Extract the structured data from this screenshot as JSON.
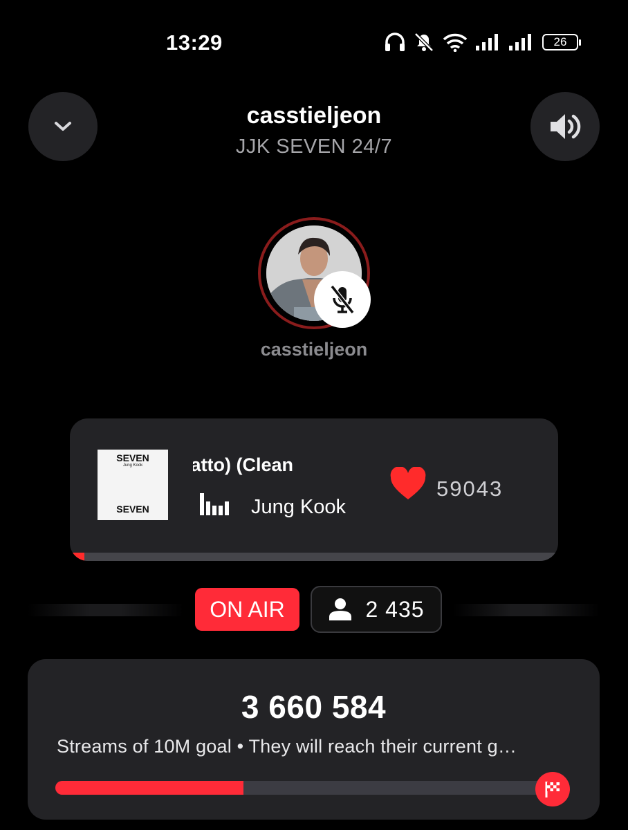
{
  "status_bar": {
    "time": "13:29",
    "battery": "26",
    "icons": [
      "headphones-icon",
      "bell-muted-icon",
      "wifi-icon",
      "signal-icon",
      "signal-icon",
      "battery-icon"
    ]
  },
  "header": {
    "title": "casstieljeon",
    "subtitle": "JJK SEVEN 24/7",
    "left_button_icon": "chevron-down-icon",
    "right_button_icon": "speaker-icon"
  },
  "host": {
    "name": "casstieljeon",
    "mic_icon": "mic-muted-icon"
  },
  "now_playing": {
    "title": "(feat. Latto) (Clean",
    "artist": "Jung Kook",
    "cover_title": "SEVEN",
    "cover_artist": "Jung Kook",
    "likes": "59043",
    "progress": 0.03,
    "accent": "#ff2b2b"
  },
  "room": {
    "on_air_label": "ON AIR",
    "listeners": "2 435"
  },
  "goal": {
    "count": "3 660 584",
    "description": "Streams of 10M goal • They will reach their current g…",
    "progress": 0.366,
    "flag_icon": "checkered-flag-icon"
  },
  "colors": {
    "background": "#000000",
    "card": "#232326",
    "accent_red": "#ff2b38",
    "avatar_ring": "#8a1c1c"
  }
}
